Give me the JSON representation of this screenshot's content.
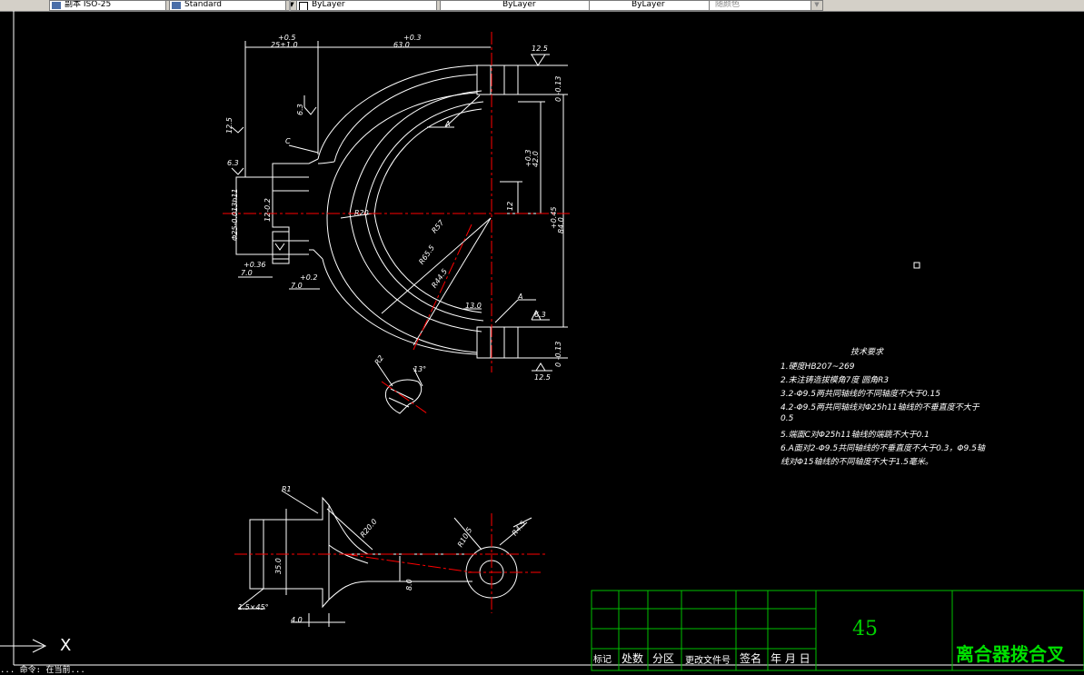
{
  "toolbar": {
    "text_style_value": "副本 ISO-25",
    "dim_style_value": "Standard",
    "layer_value": "ByLayer",
    "linetype_value": "ByLayer",
    "lineweight_value": "ByLayer",
    "color_value": "随颜色"
  },
  "drawing": {
    "dims": {
      "d_25": "25±1.0",
      "d_25_tol": "+0.5",
      "d_63": "63.0",
      "d_63_tol": "+0.3",
      "rough_125_top": "12.5",
      "rough_63_a": "6.3",
      "rough_125_left": "12.5",
      "rough_63_left": "6.3",
      "label_c": "C",
      "label_a_top": "A",
      "label_a_bot": "A",
      "d_42": "42.0",
      "d_42_tol": "+0.3",
      "d_84": "84.0",
      "d_84_tol": "+0.45",
      "d_12": "12",
      "d_r20": "R20",
      "d_r57": "R57",
      "d_r65": "R65.5",
      "d_r44": "R44.5",
      "d_13": "13.0",
      "d_7": "7.0",
      "d_7_tol": "+0.36",
      "d_d7": "7.0",
      "d_d7_tol": "+0.2",
      "d_phi25": "Φ25-0.013h11",
      "d_phi12": "12-0.2",
      "d_r2": "R2",
      "d_13b": "13°",
      "rough_63_right": "6.3",
      "rough_125_bot": "12.5",
      "tol_right_top": "0 -0.13",
      "tol_right_bot": "0 -0.13",
      "d_r1": "R1",
      "d_r20b": "R20.0",
      "d_r105": "R10.5",
      "d_r4": "R4.5",
      "d_8": "8.0",
      "d_35": "35.0",
      "d_15x45": "1.5×45°",
      "d_4": "4.0"
    },
    "tech_requirements": {
      "title": "技术要求",
      "lines": [
        "1.硬度HB207~269",
        "2.未注铸造拔模角7度 圆角R3",
        "3.2-Φ9.5两共同轴线的不同轴度不大于0.15",
        "4.2-Φ9.5两共同轴线对Φ25h11轴线的不垂直度不大于",
        "0.5",
        "5.端面C对Φ25h11轴线的端跳不大于0.1",
        "6.A面对2-Φ9.5共同轴线的不垂直度不大于0.3，Φ9.5轴",
        "线对Φ15轴线的不同轴度不大于1.5毫米。"
      ]
    },
    "title_block": {
      "headers": [
        "标记",
        "处数",
        "分区",
        "更改文件号",
        "签名",
        "年 月 日"
      ],
      "part_number": "45",
      "part_name": "离合器拨合叉"
    },
    "ucs": {
      "axis_label": "X"
    },
    "command_line": "   ... 命令: 在当前..."
  },
  "colors": {
    "background": "#000000",
    "lines": "#ffffff",
    "centerlines": "#ff0000",
    "title_block": "#00c000"
  }
}
